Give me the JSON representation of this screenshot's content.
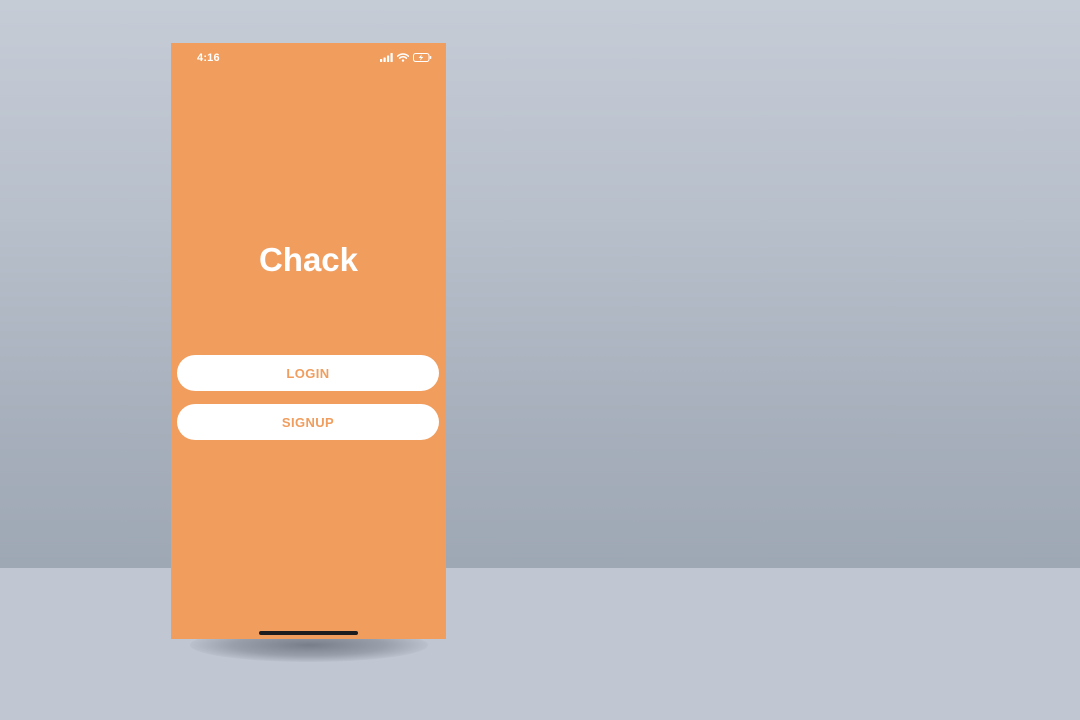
{
  "theme": {
    "accent": "#f09d5e",
    "button_text": "#f09d5e",
    "button_bg": "#ffffff",
    "title_text": "#ffffff"
  },
  "status_bar": {
    "time": "4:16",
    "icons": [
      "cellular-signal-icon",
      "wifi-icon",
      "battery-charging-icon"
    ]
  },
  "app": {
    "title": "Chack"
  },
  "buttons": {
    "login_label": "LOGIN",
    "signup_label": "SIGNUP"
  }
}
